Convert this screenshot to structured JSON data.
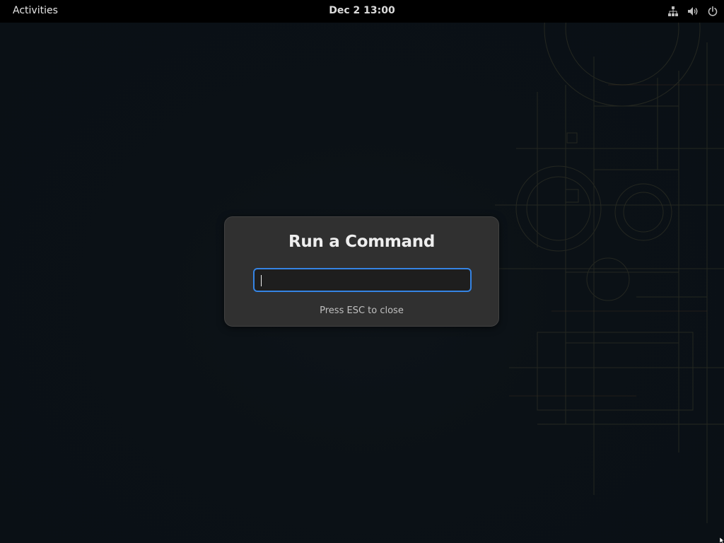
{
  "top_bar": {
    "activities_label": "Activities",
    "clock": "Dec 2  13:00",
    "status_icons": [
      "network-wired-icon",
      "volume-icon",
      "power-icon"
    ]
  },
  "dialog": {
    "title": "Run a Command",
    "input_value": "",
    "input_placeholder": "",
    "hint": "Press ESC to close"
  },
  "colors": {
    "top_bar": "#000000",
    "dialog_bg": "#303030",
    "input_bg": "#1e1e1e",
    "focus_ring": "#3584e4",
    "desktop_bg": "#0b1116",
    "wallpaper_lines": "#3a3a2a"
  }
}
